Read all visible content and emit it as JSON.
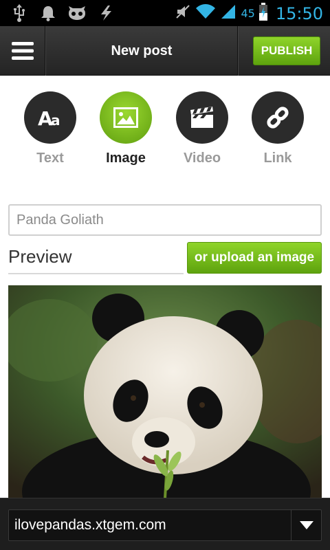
{
  "status_bar": {
    "battery_level": "45",
    "time": "15:50",
    "left_icons": [
      "usb-icon",
      "notification-bell-icon",
      "cyanogenmod-icon",
      "lightning-icon"
    ],
    "right_icons": [
      "mute-icon",
      "wifi-icon",
      "signal-icon",
      "battery-icon"
    ],
    "accent_color": "#33b5e5"
  },
  "action_bar": {
    "menu_icon": "hamburger-menu-icon",
    "title": "New post",
    "publish_label": "PUBLISH"
  },
  "post_types": [
    {
      "label": "Text",
      "icon": "text-aa-icon",
      "active": false
    },
    {
      "label": "Image",
      "icon": "image-icon",
      "active": true
    },
    {
      "label": "Video",
      "icon": "video-clapper-icon",
      "active": false
    },
    {
      "label": "Link",
      "icon": "chain-link-icon",
      "active": false
    }
  ],
  "title_field": {
    "value": "Panda Goliath"
  },
  "preview": {
    "label": "Preview",
    "upload_label": "or upload an image",
    "image_subject": "giant panda eating bamboo"
  },
  "blog_selector": {
    "value": "ilovepandas.xtgem.com",
    "icon": "dropdown-arrow-icon"
  },
  "colors": {
    "accent_green": "#7bc21f",
    "action_bar": "#2e2e2e",
    "bottom_bar": "#1e1e1e"
  }
}
